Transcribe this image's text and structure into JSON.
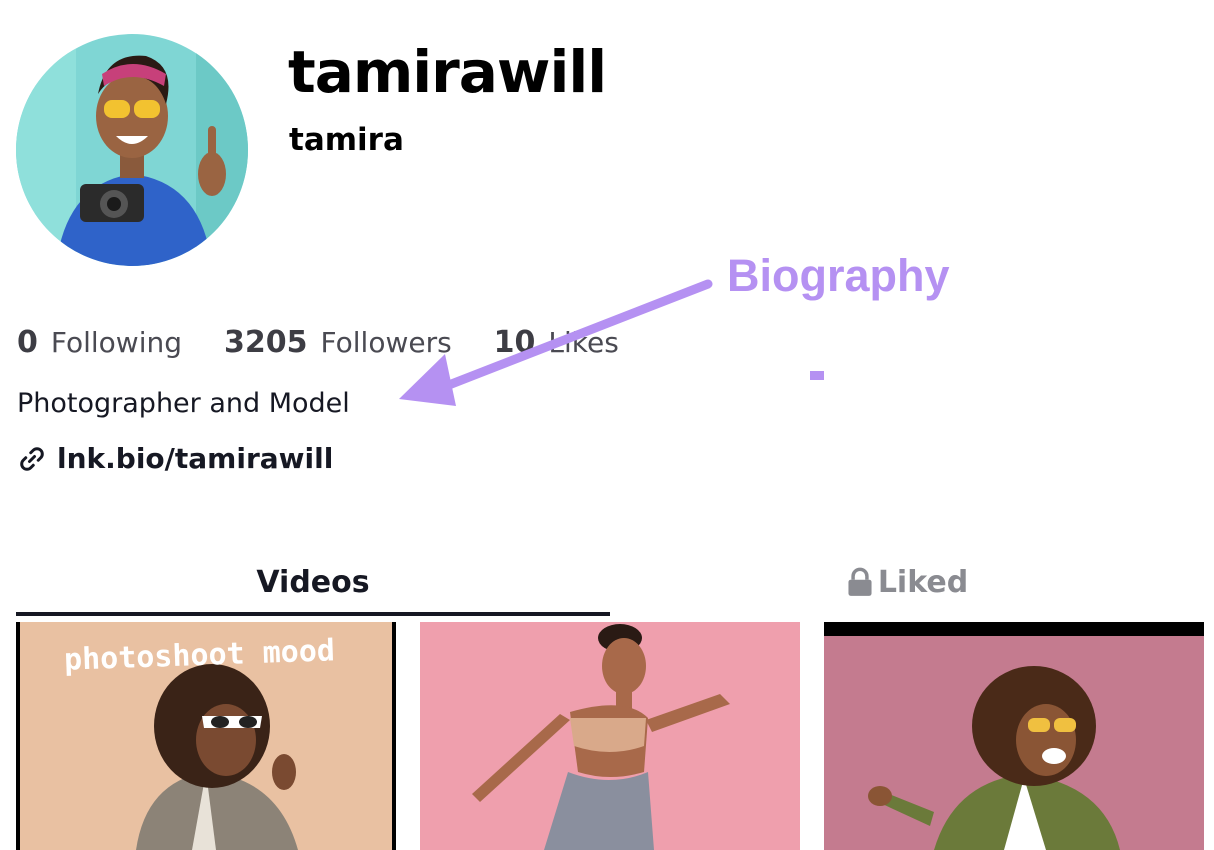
{
  "profile": {
    "username": "tamirawill",
    "nickname": "tamira",
    "bio": "Photographer and Model",
    "link": "lnk.bio/tamirawill"
  },
  "stats": [
    {
      "value": "0",
      "label": "Following"
    },
    {
      "value": "3205",
      "label": "Followers"
    },
    {
      "value": "10",
      "label": "Likes"
    }
  ],
  "annotation": {
    "label": "Biography",
    "color": "#b591f2"
  },
  "tabs": {
    "videos": "Videos",
    "liked": "Liked",
    "active": "Videos"
  },
  "videos": [
    {
      "caption": "photoshoot mood"
    },
    {
      "caption": ""
    },
    {
      "caption": ""
    }
  ],
  "icons": {
    "link": "link-icon",
    "lock": "lock-icon"
  }
}
